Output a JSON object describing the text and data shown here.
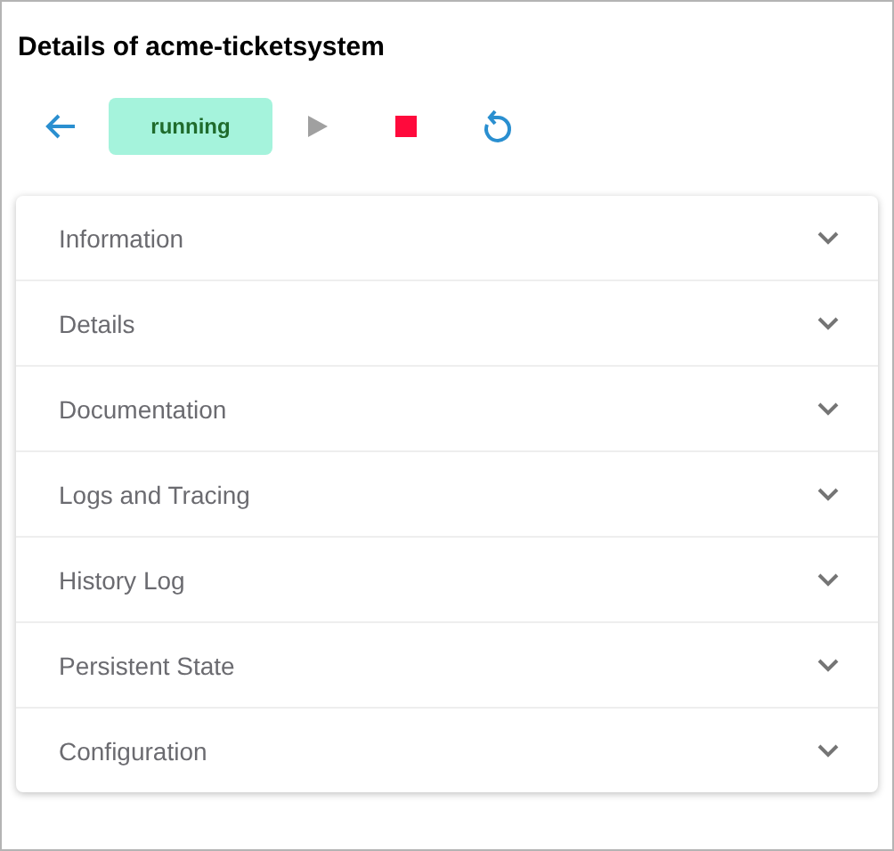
{
  "title": "Details of acme-ticketsystem",
  "toolbar": [
    {
      "kind": "back",
      "disabled": false
    },
    {
      "kind": "status",
      "label": "running"
    },
    {
      "kind": "start",
      "disabled": true
    },
    {
      "kind": "stop",
      "disabled": false
    },
    {
      "kind": "restart",
      "disabled": false
    }
  ],
  "sections": [
    {
      "title": "Information",
      "expanded": false
    },
    {
      "title": "Details",
      "expanded": false
    },
    {
      "title": "Documentation",
      "expanded": false
    },
    {
      "title": "Logs and Tracing",
      "expanded": false
    },
    {
      "title": "History Log",
      "expanded": false
    },
    {
      "title": "Persistent State",
      "expanded": false
    },
    {
      "title": "Configuration",
      "expanded": false
    }
  ]
}
